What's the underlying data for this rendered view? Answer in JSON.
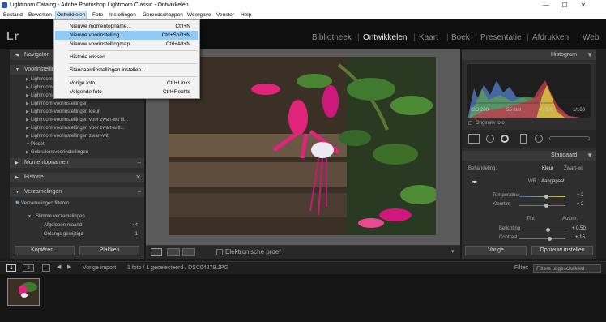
{
  "window": {
    "title": "Lightroom Catalog - Adobe Photoshop Lightroom Classic - Ontwikkelen",
    "minimize": "—",
    "maximize": "☐",
    "close": "✕"
  },
  "menu": [
    {
      "label": "Bestand"
    },
    {
      "label": "Bewerken"
    },
    {
      "label": "Ontwikkelen"
    },
    {
      "label": "Foto"
    },
    {
      "label": "Instellingen"
    },
    {
      "label": "Gereedschappen"
    },
    {
      "label": "Weergave"
    },
    {
      "label": "Venster"
    },
    {
      "label": "Help"
    }
  ],
  "dropdown": {
    "items": [
      {
        "label": "Nieuwe momentopname...",
        "shortcut": "Ctrl+N"
      },
      {
        "label": "Nieuwe voorinstelling...",
        "shortcut": "Ctrl+Shift+N"
      },
      {
        "label": "Nieuwe voorinstellingmap...",
        "shortcut": "Ctrl+Alt+N"
      },
      {
        "label": "Historie wissen",
        "shortcut": ""
      },
      {
        "label": "Standaardinstellingen instellen...",
        "shortcut": ""
      },
      {
        "label": "Vorige foto",
        "shortcut": "Ctrl+Links"
      },
      {
        "label": "Volgende foto",
        "shortcut": "Ctrl+Rechts"
      }
    ]
  },
  "logo": "Lr",
  "modules": [
    "Bibliotheek",
    "Ontwikkelen",
    "Kaart",
    "Boek",
    "Presentatie",
    "Afdrukken",
    "Web"
  ],
  "left": {
    "navigator": "Navigator",
    "presets": "Voorinstellingen",
    "preset_items": [
      "Lightroom-voorinstellingen",
      "Lightroom-voorinstellingen",
      "Lightroom-voorinstellingen",
      "Lightroom-voorinstellingen",
      "Lightroom-voorinstellingen kleur",
      "Lightroom-voorinstellingen voor zwart-wit fil...",
      "Lightroom-voorinstellingen voor zwart-witt...",
      "Lightroom-voorinstellingen zwart-wit",
      "Pieset",
      "Gebruikersvoorinstellingen"
    ],
    "snapshots": "Momentopnamen",
    "history": "Historie",
    "collections": "Verzamelingen",
    "filter_collections": "Verzamelingen filteren",
    "smart_collections": "Slimme verzamelingen",
    "coll_items": [
      {
        "label": "Afgelopen maand",
        "count": "44"
      },
      {
        "label": "Onlangs gewijzigd",
        "count": "1"
      }
    ],
    "copy": "Kopiëren...",
    "paste": "Plakken"
  },
  "toolbar": {
    "soft_proof": "Elektronische proef"
  },
  "right": {
    "histogram": "Histogram",
    "iso": "ISO 200",
    "focal": "55 mm",
    "fstop": "f / 5,6",
    "shutter": "1/160",
    "original": "Originele foto",
    "basic": "Standaard",
    "treatment": "Behandeling:",
    "color": "Kleur",
    "bw": "Zwart-wit",
    "wb_label": "WB :",
    "wb_value": "Aangepast",
    "temp": "Temperatuur",
    "temp_val": "+ 2",
    "tint": "Kleurtint",
    "tint_val": "+ 2",
    "tone": "Tint",
    "auto": "Autom.",
    "exposure": "Belichting",
    "exposure_val": "+ 0,50",
    "contrast": "Contrast",
    "contrast_val": "+ 15",
    "previous": "Vorige",
    "reset": "Opnieuw instellen"
  },
  "filmbar": {
    "prev_import": "Vorige import",
    "info": "1 foto / 1 geselecteerd / DSC04279.JPG",
    "filter": "Filter:",
    "filter_value": "Filters uitgeschakeld"
  },
  "screens": [
    "1",
    "2"
  ],
  "colors": {
    "magenta": "#e0247a",
    "accent": "#f2f2f2"
  }
}
